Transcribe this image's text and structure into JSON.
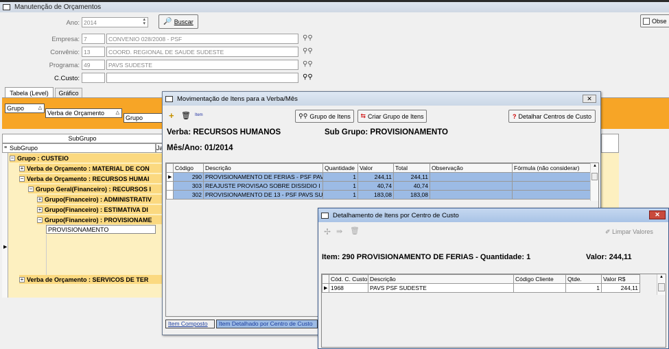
{
  "main": {
    "title": "Manutenção de Orçamentos",
    "obs_button": "Obse",
    "ano": {
      "label": "Ano:",
      "value": "2014"
    },
    "buscar": "Buscar",
    "empresa": {
      "label": "Empresa:",
      "code": "7",
      "name": "CONVENIO 028/2008 - PSF"
    },
    "convenio": {
      "label": "Convênio:",
      "code": "13",
      "name": "COORD. REGIONAL DE SAUDE SUDESTE"
    },
    "programa": {
      "label": "Programa:",
      "code": "49",
      "name": "PAVS SUDESTE"
    },
    "ccusto": {
      "label": "C.Custo:",
      "code": "",
      "name": ""
    },
    "tabs": [
      "Tabela (Level)",
      "Gráfico"
    ],
    "group_chips": [
      "Grupo",
      "Verba de Orçamento",
      "Grupo Geral(Fi"
    ],
    "grid_header": "SubGrupo",
    "grid_col": "SubGrupo",
    "grid_col2": "Ja",
    "tree": [
      "Grupo : CUSTEIO",
      "Verba de Orçamento : MATERIAL DE CON",
      "Verba de Orçamento : RECURSOS HUMAI",
      "Grupo Geral(Financeiro) : RECURSOS I",
      "Grupo(Financeiro) : ADMINISTRATIV",
      "Grupo(Financeiro) : ESTIMATIVA DI",
      "Grupo(Financeiro) : PROVISIONAME",
      "PROVISIONAMENTO",
      "Verba de Orçamento : SERVICOS DE TER"
    ]
  },
  "mov": {
    "title": "Movimentação de Itens para a Verba/Mês",
    "toolbar_small": "Item",
    "grupo_itens": "Grupo de Itens",
    "criar_grupo": "Criar Grupo de Itens",
    "detalhar": "Detalhar Centros de Custo",
    "verba": "Verba: RECURSOS HUMANOS",
    "subgrupo": "Sub Grupo: PROVISIONAMENTO",
    "mesano": "Mês/Ano: 01/2014",
    "columns": [
      "Código",
      "Descrição",
      "Quantidade",
      "Valor",
      "Total",
      "Observação",
      "Fórmula (não considerar)"
    ],
    "rows": [
      [
        "290",
        "PROVISIONAMENTO DE FERIAS - PSF PAV",
        "1",
        "244,11",
        "244,11",
        "",
        ""
      ],
      [
        "303",
        "REAJUSTE PROVISAO SOBRE DISSIDIO I",
        "1",
        "40,74",
        "40,74",
        "",
        ""
      ],
      [
        "302",
        "PROVISIONAMENTO DE 13 - PSF PAVS SU",
        "1",
        "183,08",
        "183,08",
        "",
        ""
      ]
    ],
    "tab1": "Item Composto",
    "tab2": "Item Detalhado por Centro de Custo"
  },
  "det": {
    "title": "Detalhamento de Itens por Centro de Custo",
    "limpar": "Limpar Valores",
    "item": "Item: 290  PROVISIONAMENTO DE FERIAS - Quantidade: 1",
    "valor": "Valor: 244,11",
    "columns": [
      "Cód. C. Custo",
      "Descrição",
      "Código Cliente",
      "Qtde.",
      "Valor R$"
    ],
    "rows": [
      [
        "1968",
        "PAVS PSF SUDESTE",
        "",
        "1",
        "244,11"
      ]
    ]
  }
}
